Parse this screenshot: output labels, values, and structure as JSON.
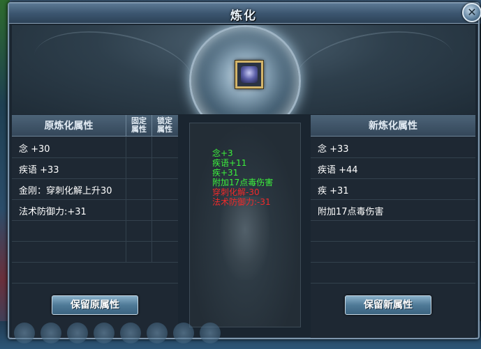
{
  "window": {
    "title": "炼化"
  },
  "old_panel": {
    "header": {
      "title": "原炼化属性",
      "fixed": "固定\n属性",
      "locked": "锁定\n属性"
    },
    "rows": [
      {
        "text": "念 +30"
      },
      {
        "text": "疾语 +33"
      },
      {
        "text": "金刚：穿刺化解上升30"
      },
      {
        "text": "法术防御力:+31"
      },
      {
        "text": ""
      },
      {
        "text": ""
      },
      {
        "text": ""
      }
    ],
    "keep_button": "保留原属性"
  },
  "new_panel": {
    "header": {
      "title": "新炼化属性"
    },
    "rows": [
      {
        "text": "念 +33"
      },
      {
        "text": "疾语 +44"
      },
      {
        "text": "疾 +31"
      },
      {
        "text": "附加17点毒伤害"
      },
      {
        "text": ""
      },
      {
        "text": ""
      },
      {
        "text": ""
      }
    ],
    "keep_button": "保留新属性"
  },
  "changes": [
    {
      "text": "念+3",
      "type": "up"
    },
    {
      "text": "疾语+11",
      "type": "up"
    },
    {
      "text": "疾+31",
      "type": "up"
    },
    {
      "text": "附加17点毒伤害",
      "type": "up"
    },
    {
      "text": "穿刺化解-30",
      "type": "down"
    },
    {
      "text": "法术防御力:-31",
      "type": "down"
    }
  ],
  "colors": {
    "increase": "#3cf03c",
    "decrease": "#f22a2a"
  },
  "icons": {
    "close": "close-icon",
    "item": "item-slot-icon"
  }
}
